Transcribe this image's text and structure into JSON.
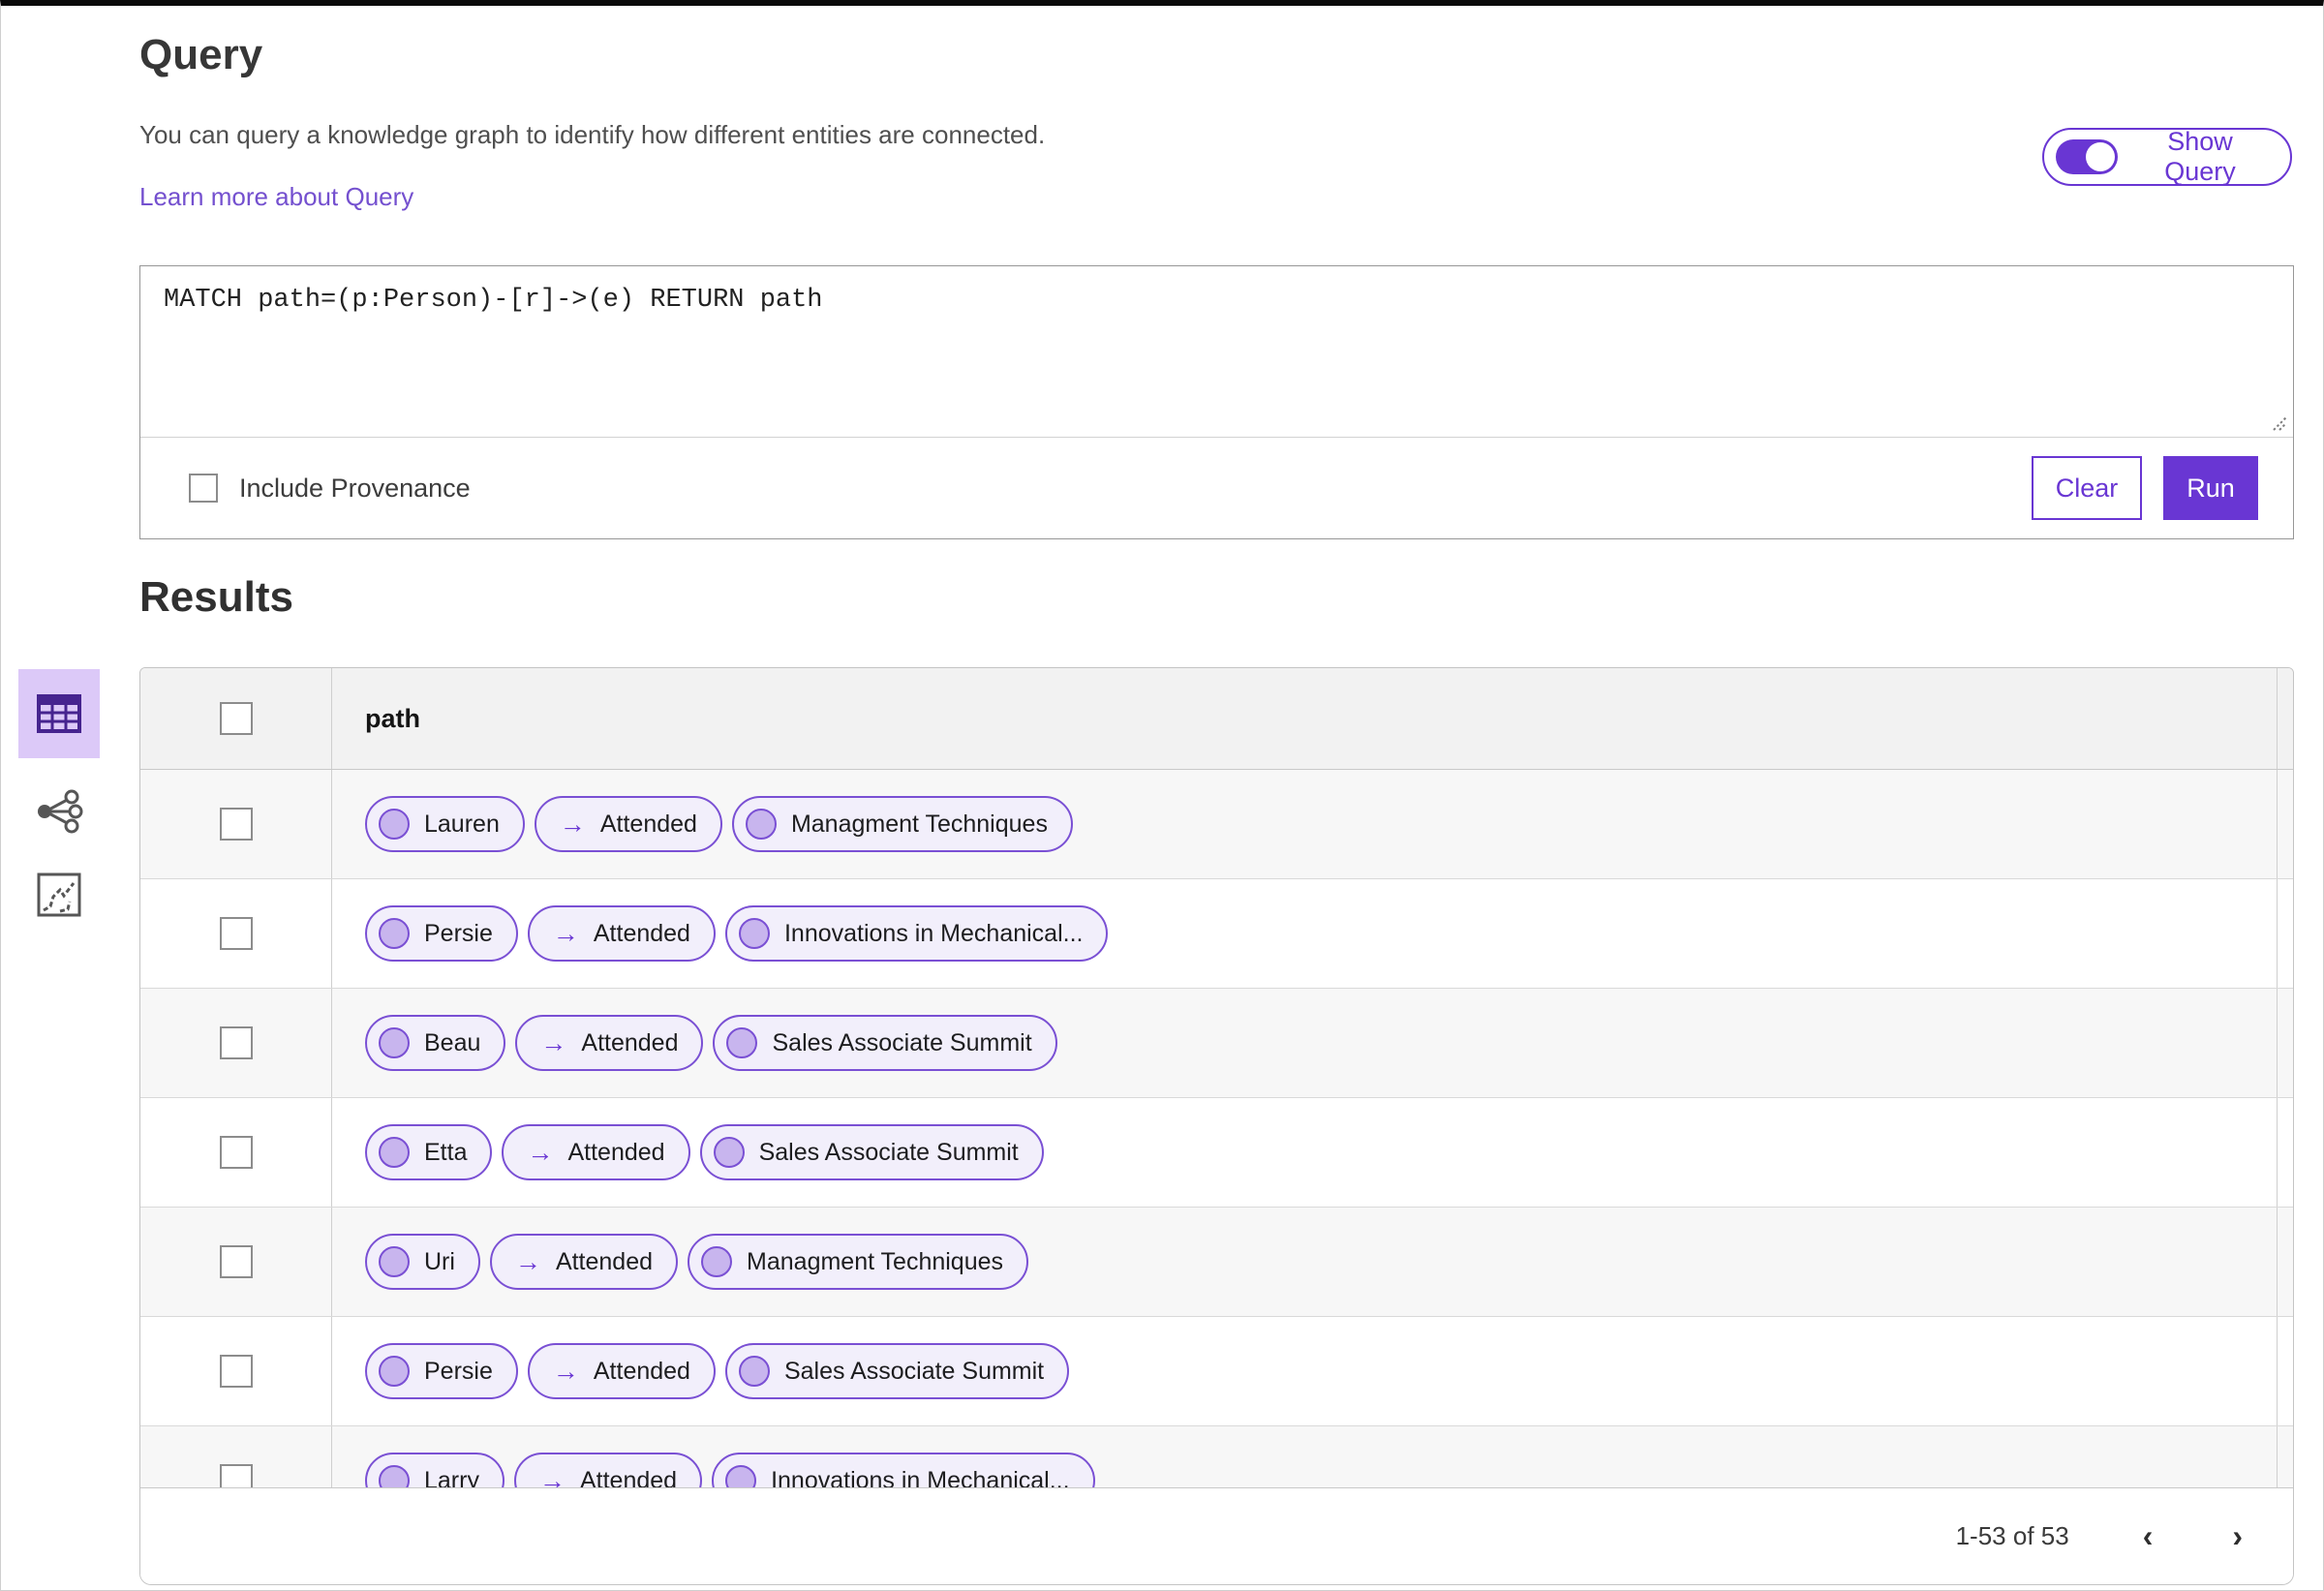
{
  "query_section": {
    "title": "Query",
    "description": "You can query a knowledge graph to identify how different entities are connected.",
    "learn_more": "Learn more about Query",
    "show_query_label": "Show Query",
    "show_query_state": "on",
    "query_text": "MATCH path=(p:Person)-[r]->(e) RETURN path",
    "include_provenance_label": "Include Provenance",
    "include_provenance_checked": false,
    "clear_label": "Clear",
    "run_label": "Run"
  },
  "results_section": {
    "title": "Results",
    "selected_view": "table",
    "column_header": "path",
    "edge_arrow": "→",
    "rows": [
      {
        "source": "Lauren",
        "relation": "Attended",
        "target": "Managment Techniques"
      },
      {
        "source": "Persie",
        "relation": "Attended",
        "target": "Innovations in Mechanical..."
      },
      {
        "source": "Beau",
        "relation": "Attended",
        "target": "Sales Associate Summit"
      },
      {
        "source": "Etta",
        "relation": "Attended",
        "target": "Sales Associate Summit"
      },
      {
        "source": "Uri",
        "relation": "Attended",
        "target": "Managment Techniques"
      },
      {
        "source": "Persie",
        "relation": "Attended",
        "target": "Sales Associate Summit"
      },
      {
        "source": "Larry",
        "relation": "Attended",
        "target": "Innovations in Mechanical..."
      }
    ],
    "pagination": {
      "range_label": "1-53 of 53",
      "prev": "‹",
      "next": "›"
    }
  },
  "icons": {
    "table-view-icon": "table grid",
    "graph-view-icon": "network nodes",
    "chart-view-icon": "line chart in square",
    "resize-gripper-icon": "diagonal drag lines",
    "node-dot-icon": "filled circle",
    "edge-arrow-icon": "right arrow"
  },
  "colors": {
    "accent_purple": "#6936d3",
    "pill_border": "#7a50d4",
    "pill_background": "#f2effb",
    "pill_dot": "#c8b5ee",
    "selected_view_background": "#dcc9f8",
    "header_row_background": "#f2f2f2",
    "alt_row_background": "#f7f7f7",
    "link_purple": "#7450cf"
  }
}
